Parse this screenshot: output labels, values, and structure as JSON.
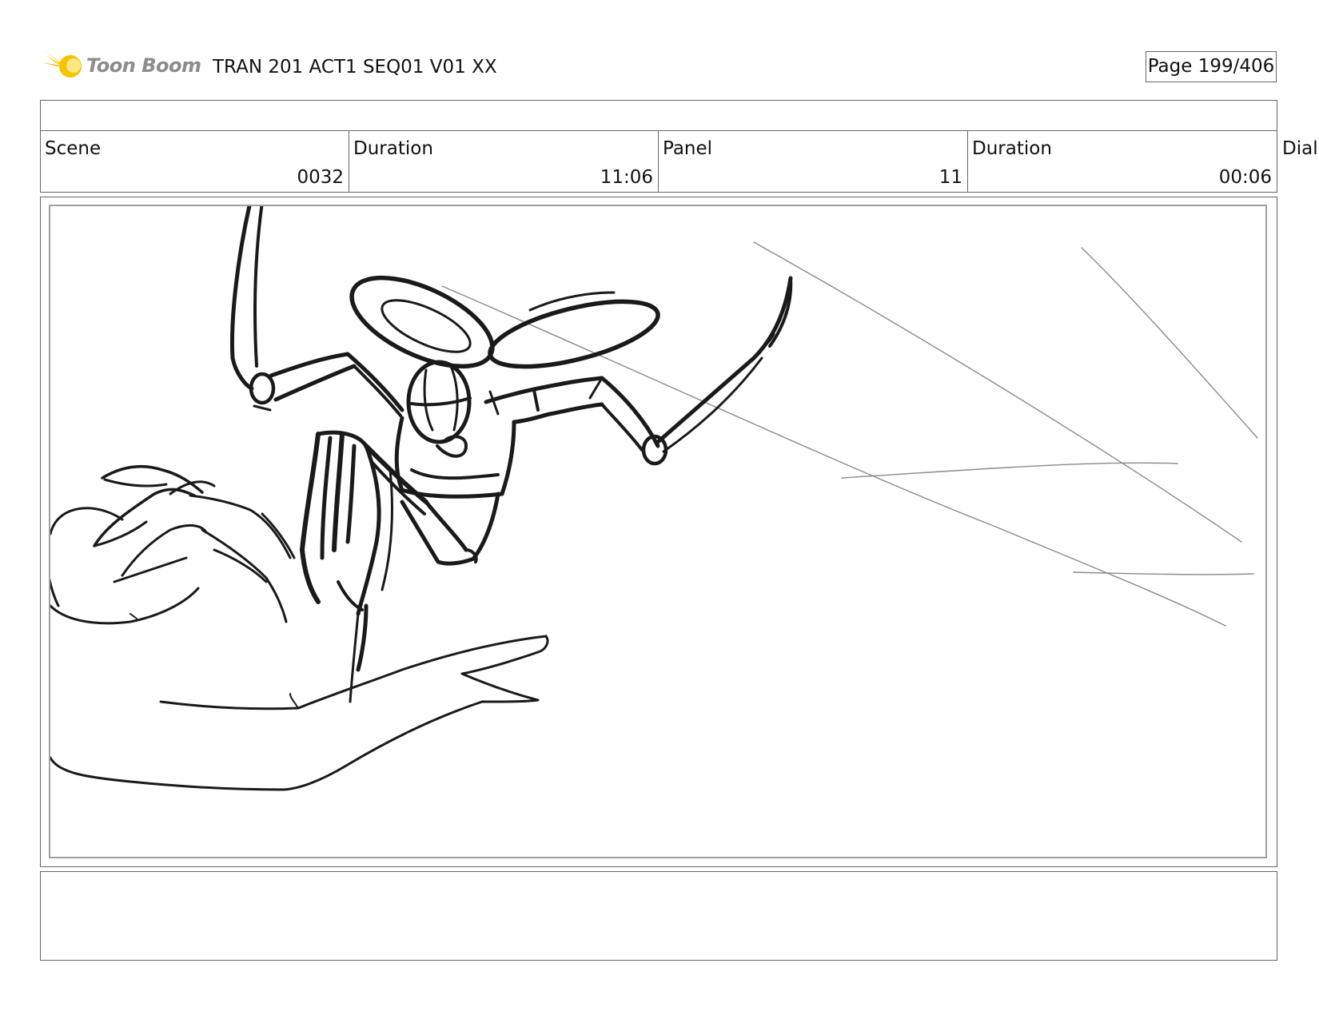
{
  "header": {
    "logo_text": "Toon Boom",
    "title": "TRAN 201 ACT1 SEQ01 V01 XX",
    "page_label": "Page 199/406"
  },
  "info": [
    {
      "label": "Scene",
      "value": "0032"
    },
    {
      "label": "Duration",
      "value": "11:06"
    },
    {
      "label": "Panel",
      "value": "11"
    },
    {
      "label": "Duration",
      "value": "00:06"
    }
  ],
  "dialog_label": "Dialog",
  "colors": {
    "logo_star": "#f5c400",
    "logo_text": "#8c8c8c",
    "border": "#666666",
    "sketch_ink": "#1a1a1a",
    "speed_lines": "#8a8a8a"
  }
}
